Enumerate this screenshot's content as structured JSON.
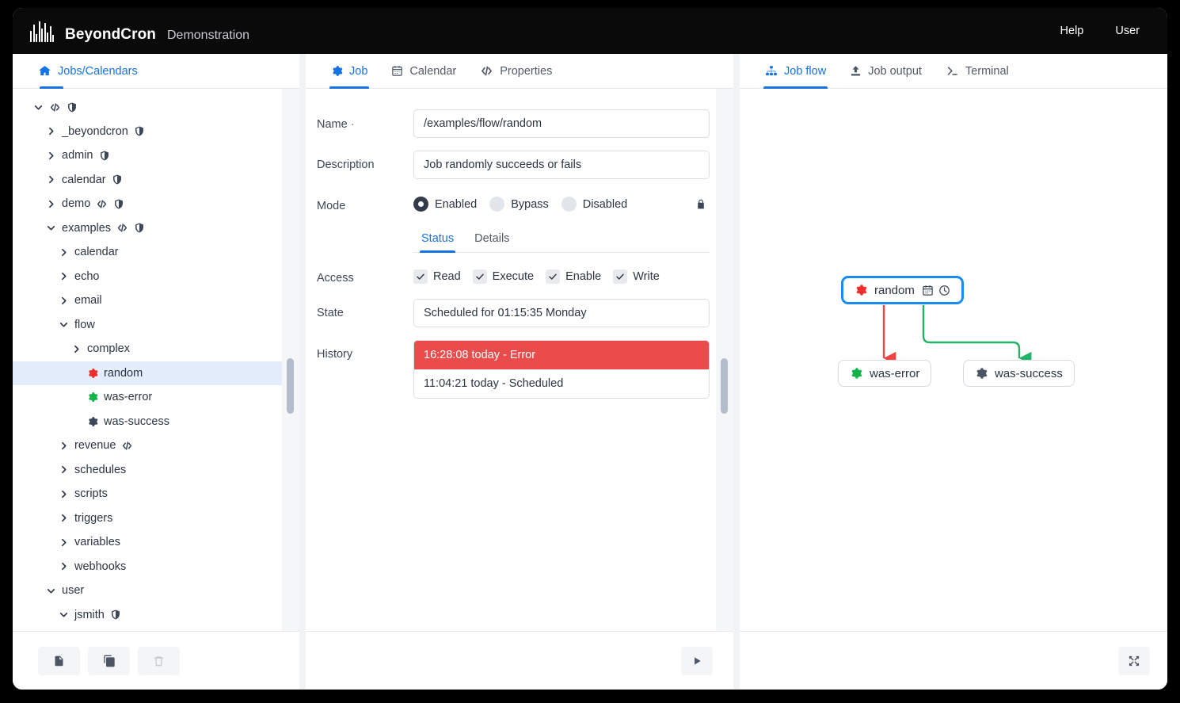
{
  "header": {
    "brand_name": "BeyondCron",
    "subtitle": "Demonstration",
    "help_label": "Help",
    "user_label": "User"
  },
  "sidebar": {
    "tab_label": "Jobs/Calendars",
    "tree": [
      {
        "label": "",
        "depth": 0,
        "state": "open",
        "icons": [
          "code",
          "shield"
        ],
        "selected": false
      },
      {
        "label": "_beyondcron",
        "depth": 1,
        "state": "closed",
        "icons": [
          "shield"
        ],
        "selected": false
      },
      {
        "label": "admin",
        "depth": 1,
        "state": "closed",
        "icons": [
          "shield"
        ],
        "selected": false
      },
      {
        "label": "calendar",
        "depth": 1,
        "state": "closed",
        "icons": [
          "shield"
        ],
        "selected": false
      },
      {
        "label": "demo",
        "depth": 1,
        "state": "closed",
        "icons": [
          "code",
          "shield"
        ],
        "selected": false
      },
      {
        "label": "examples",
        "depth": 1,
        "state": "open",
        "icons": [
          "code",
          "shield"
        ],
        "selected": false
      },
      {
        "label": "calendar",
        "depth": 2,
        "state": "closed",
        "icons": [],
        "selected": false
      },
      {
        "label": "echo",
        "depth": 2,
        "state": "closed",
        "icons": [],
        "selected": false
      },
      {
        "label": "email",
        "depth": 2,
        "state": "closed",
        "icons": [],
        "selected": false
      },
      {
        "label": "flow",
        "depth": 2,
        "state": "open",
        "icons": [],
        "selected": false
      },
      {
        "label": "complex",
        "depth": 3,
        "state": "closed",
        "icons": [],
        "selected": false
      },
      {
        "label": "random",
        "depth": 3,
        "state": "leaf",
        "icons": [
          "gear-red"
        ],
        "selected": true
      },
      {
        "label": "was-error",
        "depth": 3,
        "state": "leaf",
        "icons": [
          "gear-green"
        ],
        "selected": false
      },
      {
        "label": "was-success",
        "depth": 3,
        "state": "leaf",
        "icons": [
          "gear-gray"
        ],
        "selected": false
      },
      {
        "label": "revenue",
        "depth": 2,
        "state": "closed",
        "icons": [
          "code"
        ],
        "selected": false
      },
      {
        "label": "schedules",
        "depth": 2,
        "state": "closed",
        "icons": [],
        "selected": false
      },
      {
        "label": "scripts",
        "depth": 2,
        "state": "closed",
        "icons": [],
        "selected": false
      },
      {
        "label": "triggers",
        "depth": 2,
        "state": "closed",
        "icons": [],
        "selected": false
      },
      {
        "label": "variables",
        "depth": 2,
        "state": "closed",
        "icons": [],
        "selected": false
      },
      {
        "label": "webhooks",
        "depth": 2,
        "state": "closed",
        "icons": [],
        "selected": false
      },
      {
        "label": "user",
        "depth": 1,
        "state": "open",
        "icons": [],
        "selected": false
      },
      {
        "label": "jsmith",
        "depth": 2,
        "state": "open",
        "icons": [
          "shield"
        ],
        "selected": false
      }
    ],
    "footer_buttons": [
      {
        "name": "new-job-button",
        "icon": "file-icon",
        "disabled": false
      },
      {
        "name": "copy-job-button",
        "icon": "copy-icon",
        "disabled": false
      },
      {
        "name": "delete-job-button",
        "icon": "trash-icon",
        "disabled": true
      }
    ]
  },
  "center": {
    "tabs": [
      {
        "label": "Job",
        "icon": "gear-icon",
        "active": true
      },
      {
        "label": "Calendar",
        "icon": "calendar-icon",
        "active": false
      },
      {
        "label": "Properties",
        "icon": "code-icon",
        "active": false
      }
    ],
    "fields": {
      "name_label": "Name",
      "name_required_mark": "·",
      "name_value": "/examples/flow/random",
      "description_label": "Description",
      "description_value": "Job randomly succeeds or fails",
      "mode_label": "Mode",
      "state_label": "State",
      "state_value": "Scheduled for 01:15:35 Monday",
      "history_label": "History",
      "access_label": "Access"
    },
    "mode_options": [
      {
        "label": "Enabled",
        "selected": true
      },
      {
        "label": "Bypass",
        "selected": false
      },
      {
        "label": "Disabled",
        "selected": false
      }
    ],
    "subtabs": [
      {
        "label": "Status",
        "active": true
      },
      {
        "label": "Details",
        "active": false
      }
    ],
    "access_options": [
      {
        "label": "Read",
        "checked": true
      },
      {
        "label": "Execute",
        "checked": true
      },
      {
        "label": "Enable",
        "checked": true
      },
      {
        "label": "Write",
        "checked": true
      }
    ],
    "history": [
      {
        "text": "16:28:08 today - Error",
        "status": "error"
      },
      {
        "text": "11:04:21 today - Scheduled",
        "status": "scheduled"
      }
    ],
    "run_button_label": "Run"
  },
  "right": {
    "tabs": [
      {
        "label": "Job flow",
        "icon": "sitemap-icon",
        "active": true
      },
      {
        "label": "Job output",
        "icon": "upload-icon",
        "active": false
      },
      {
        "label": "Terminal",
        "icon": "terminal-icon",
        "active": false
      }
    ],
    "flow": {
      "nodes": [
        {
          "id": "random",
          "label": "random",
          "gear_color": "red",
          "primary": true,
          "badges": [
            "calendar-icon",
            "clock-icon"
          ]
        },
        {
          "id": "was-error",
          "label": "was-error",
          "gear_color": "green",
          "primary": false,
          "badges": []
        },
        {
          "id": "was-success",
          "label": "was-success",
          "gear_color": "gray",
          "primary": false,
          "badges": []
        }
      ],
      "edges": [
        {
          "from": "random",
          "to": "was-error",
          "color": "#ef4444"
        },
        {
          "from": "random",
          "to": "was-success",
          "color": "#22b268"
        }
      ]
    },
    "expand_button_label": "Expand"
  },
  "colors": {
    "accent": "#1573e6",
    "error": "#ea4c4c",
    "success": "#22b268",
    "node_border": "#1a8cf0",
    "selected_row": "#e4edfb"
  }
}
